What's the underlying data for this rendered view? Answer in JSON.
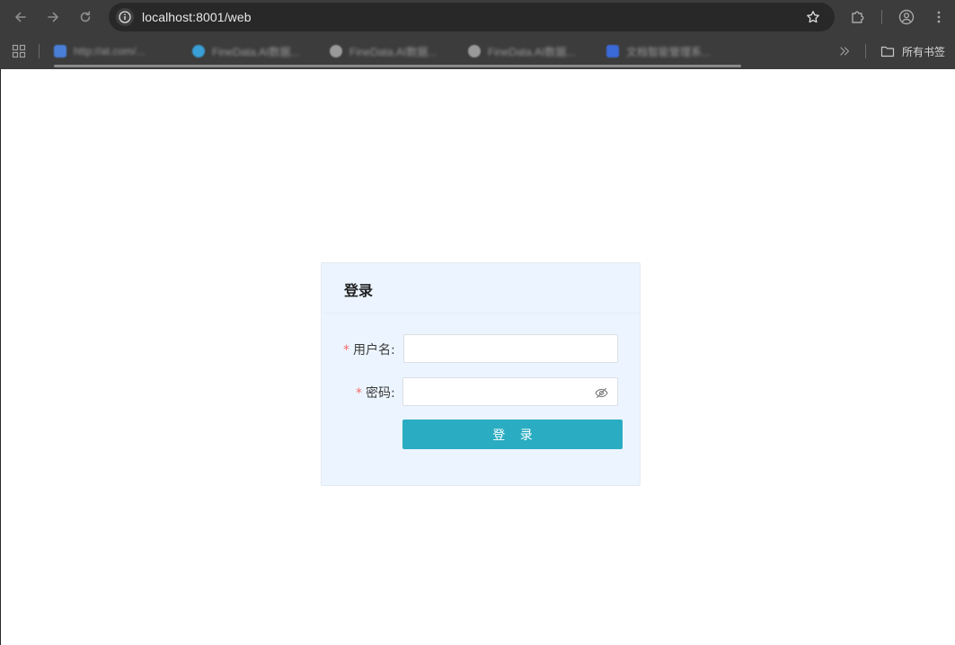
{
  "browser": {
    "url": "localhost:8001/web",
    "all_bookmarks_label": "所有书签",
    "bookmarks": [
      {
        "label": "http://at.com/...",
        "color": "#4a7fd8"
      },
      {
        "label": "FineData.AI数据...",
        "color": "#3aa0d8"
      },
      {
        "label": "FineData.AI数据...",
        "color": "#9a9a9a"
      },
      {
        "label": "FineData.AI数据...",
        "color": "#9a9a9a"
      },
      {
        "label": "文档智能管理系...",
        "color": "#3a6ad8"
      }
    ]
  },
  "login": {
    "title": "登录",
    "username_label": "用户名",
    "username_value": "",
    "password_label": "密码",
    "password_value": "",
    "required_mark": "*",
    "colon": ":",
    "submit_label": "登 录"
  },
  "colors": {
    "accent": "#2aadc2",
    "card_bg": "#ecf5ff",
    "required": "#f56c6c"
  }
}
